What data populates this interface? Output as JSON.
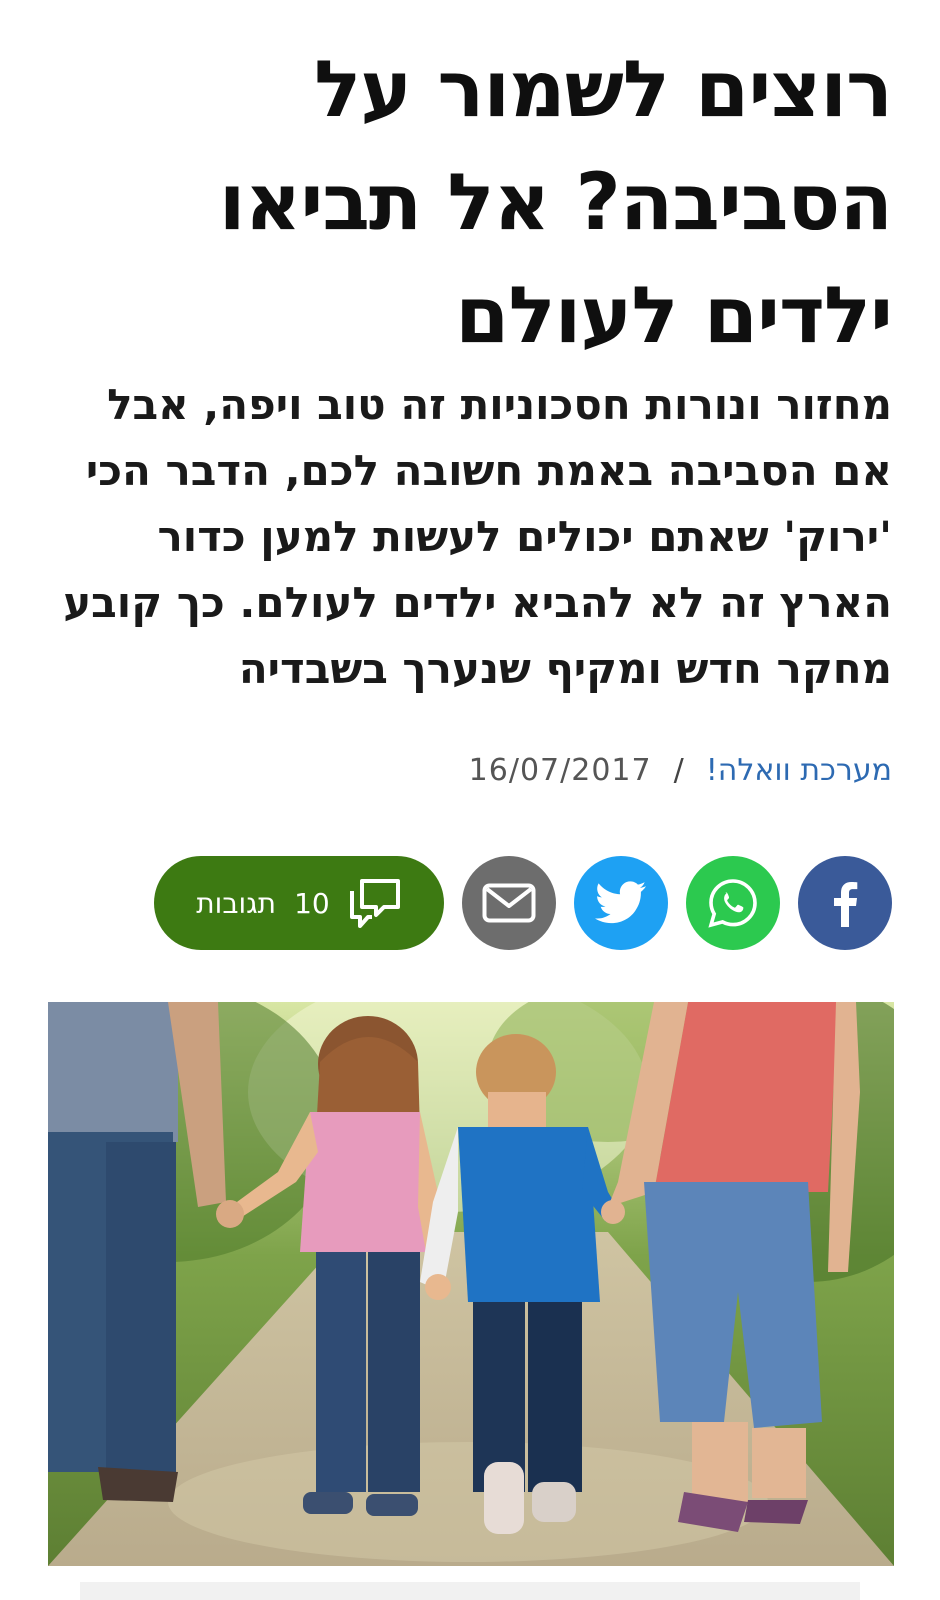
{
  "article": {
    "headline_lines": [
      "רוצים לשמור על",
      "הסביבה? אל תביאו",
      "ילדים לעולם"
    ],
    "subtitle_lines": [
      "מחזור ונורות חסכוניות זה טוב ויפה, אבל",
      "אם הסביבה באמת חשובה לכם, הדבר הכי",
      "'ירוק' שאתם יכולים לעשות למען כדור",
      "הארץ זה לא להביא ילדים לעולם. כך קובע",
      "מחקר חדש ומקיף שנערך בשבדיה"
    ],
    "author": "מערכת וואלה!",
    "separator": "/",
    "date": "16/07/2017"
  },
  "share": {
    "facebook_icon": "facebook-icon",
    "whatsapp_icon": "whatsapp-icon",
    "twitter_icon": "twitter-icon",
    "email_icon": "mail-icon",
    "comments_count": "10",
    "comments_label": "תגובות",
    "colors": {
      "facebook": "#3a5a99",
      "whatsapp": "#2cc94f",
      "twitter": "#1ea1f3",
      "email": "#6d6d6d",
      "comments": "#3d7a12"
    }
  },
  "hero_image": {
    "icon": "family-walking-photo"
  }
}
